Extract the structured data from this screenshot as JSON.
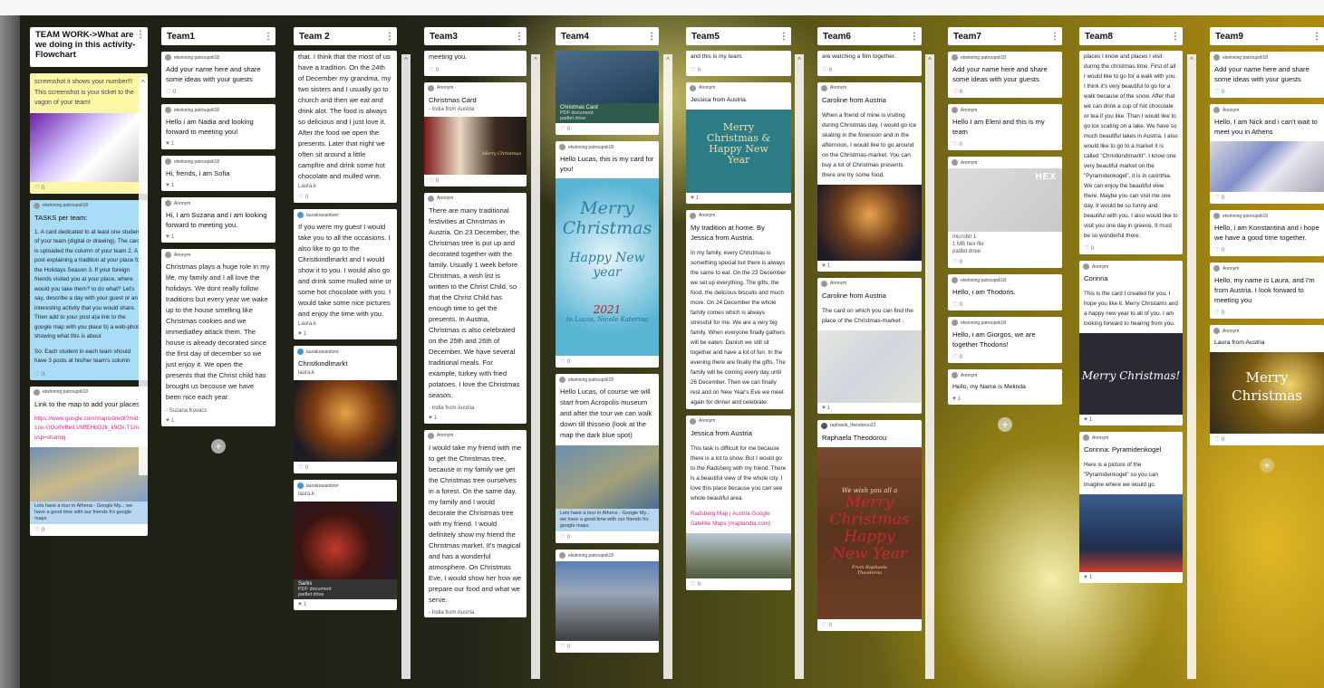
{
  "col0": {
    "header": "TEAM WORK->What are we doing in this activity- Flowchart",
    "c1_text": "screenshot it shows your number!!! This screenshot is your ticket to the vagon of your team!",
    "c2_author": "etwinning patroupoli18",
    "c2_title": "TASKS per team:",
    "c2_body": "1. A card dedicated to at least one student of your team (digital or drawing). The card is uploaded the column of your team 2. A post explaining a tradition at your place for the Holidays Season 3. If your foreign friends visited you at your place, where would you take them? to do what? Let's say, describe a day with your guest or an interesting activity that you would share. Then add to your post a)a link to the google map with you place b) a web-photo showing what this is about",
    "c2_body2": "So: Each student in each team should have 3 posts at his/her team's column",
    "c3_author": "etwinning patroupoli18",
    "c3_title": "Link to the map to add your places",
    "c3_link": "https://www.google.com/maps/d/edit?mid=1nu-GOo0VBeILVMfEHbO2k_k9Ox-T1zI&usp=sharing",
    "c3_cap": "Lets have a tour in Athena - Google My... we have a good time with our friends fro google maps",
    "likes": "0"
  },
  "col1": {
    "header": "Team1",
    "c1_author": "etwinning patroupoli18",
    "c1": "Add your name here and share some ideas with your guests",
    "c2_author": "etwinning patroupoli18",
    "c2": "Hello i am Nadia and looking forward to meeting you!",
    "c3_author": "etwinning patroupoli18",
    "c3": "Hi, frends, i am Sofia",
    "c4_author": "Anonym",
    "c4": "Hi, I am Suzana and i am looking forward to meeting you.",
    "c5_author": "Anonym",
    "c5": "Christmas plays a huge role in my life, my family and I all love the holidays. We dont really follow traditions but every year we wake up to the house smelling like Christmas cookies and we immediatley attack them. The house is already decorated since the first day of december so we just enjoy it. We open the presents that the Christ child has brought us becouse we have been nice each year.",
    "c5_sign": "- Suzana Kovacs",
    "likes1": "0",
    "likes2": "1",
    "likes3": "1",
    "likes4": "1",
    "likes5": "1"
  },
  "col2": {
    "header": "Team 2",
    "c1": "that. I think that the most of us have a tradition. On the 24th of December my grandma, my two sisters and I usually go to church and then we eat and drink alot. The food is always so delicious and I just love it. After the food we open the presents. Later that night we often sit around a little campfire and drink some hot chocolate and mulled wine.",
    "c1_sign": "Laura.k",
    "c2_author": "laurakrasanitzer",
    "c2": "If you were my guest I would take you to all the occasions. I also like to go to the Christkindlmarkt and I would show it to you. I would also go and drink some mulled wine or some hot chocolate with you. I would take some nice pictures and enjoy the time with you.",
    "c2_sign": "Laura.k",
    "c3_author": "laurakrasanitzer",
    "c3": "Christkindlmarkt",
    "c3_sign": "laura.k",
    "c4_author": "laurakrasanitzer",
    "c4_sign": "laura.k",
    "c4_file": "Sarks",
    "c4_filetype": "PDF document",
    "c4_src": "padlet drive",
    "likes1": "0",
    "likes2": "1",
    "likes3": "0",
    "likes4": "1"
  },
  "col3": {
    "header": "Team3",
    "c1": "meeting you.",
    "c2_author": "Anonym",
    "c2": "Christmas Card",
    "c2_sign": "- India from Austria",
    "c2_img": "Merry Christmas",
    "c3_author": "Anonym",
    "c3": "There are many traditional festivities at Christmas in Austria. On 23 December, the Christmas tree is put up and decorated together with the family. Usually 1 week before Christmas, a wish list is written to the Christ Child, so that the Christ Child has enough time to get the presents. In Austria, Christmas is also celebrated on the 25th and 26th of December. We have several traditional meals. For example, turkey with fried potatoes. I love the Christmas season.",
    "c3_sign": "- India from Austria",
    "c4_author": "Anonym",
    "c4": "I would take my friend with me to get the Christmas tree, because in my family we get the Christmas tree ourselves in a forest. On the same day, my family and I would decorate the Christmas tree with my friend. I would definitely show my friend the Christmas market. It's magical and has a wonderful atmosphere. On Christmas Eve, I would show her how we prepare our food and what we serve.",
    "c4_sign": "- India from Austria",
    "likes1": "0",
    "likes2": "0",
    "likes3": "1"
  },
  "col4": {
    "header": "Team4",
    "c1_file": "Christmas Card",
    "c1_filetype": "PDF document",
    "c1_src": "padlet drive",
    "c2_author": "etwinning patroupoli18",
    "c2": "Hello Lucas, this is my card for you!",
    "c2_img1": "Merry Christmas",
    "c2_img2": "Happy New year",
    "c2_img3": "2021",
    "c2_img4": "to Lucas, Nicole Katerina",
    "c3_author": "etwinning patroupoli18",
    "c3": "Hello Lucas, of course we will start from Acropolis museum and after the tour we can walk down till thisseio (look at the map the dark blue spot)",
    "c3_cap": "Lets have a tour in Athens - Google My... we have a good time with our friends fro google maps",
    "c4_author": "etwinning patroupoli18",
    "likes1": "0",
    "likes2": "0",
    "likes3": "0",
    "likes4": "0"
  },
  "col5": {
    "header": "Team5",
    "c1": "and this is my team.",
    "c2_author": "Anonym",
    "c2": "Jessica from Austria.",
    "c2_img": "Merry Christmas & Happy New Year",
    "c3_author": "Anonym",
    "c3": "My tradition at home. By Jessica from Austria.",
    "c3_body": "In my family, every Christmas is something special but there is always the same to eat. On the 23 December we set up everything. The gifts, the food, the delicious biscuits and much more. On 24 December the whole family comes which is always stressful for me. We are a very big family. When everyone finally gathers will be eaten. Danish we still sit together and have a lot of fun. In the evening there are finally the gifts. The family will be coming every day until 26 December. Then we can finally rest and on New Year's Eve we meet again for dinner and celebrate.",
    "c4_author": "Anonym",
    "c4": "Jessica from Austria",
    "c4_body": "This task is difficult for me because there is a lot to show. But I would go to the Radsberg with my friend. There is a beautiful view of the whole city. I love this place because you can see whole beautiful area.",
    "c4_link": "Radsberg Map | Austria Google Satellite Maps (maplandia.com)",
    "likes1": "0",
    "likes2": "1",
    "likes3": "0"
  },
  "col6": {
    "header": "Team6",
    "c1": "are watching a film together.",
    "c2_author": "Anonym",
    "c2": "Caroline from Austria",
    "c2_body": "When a friend of mine is visiting during Christmas day, I would go ice skating in the forenoon and in the afternoon, I would like to go around on the Christmas-market. You can buy a lot of Christmas presents there ore try some food.",
    "c3_author": "Anonym",
    "c3": "Caroline from Austria",
    "c3_body": "The card on which you can find the place of the Christmas-market .",
    "c4_author": "raphaela_theodorou22",
    "c4": "Raphaela Theodorou",
    "c4_img1": "We wish you all a",
    "c4_img2": "Merry Christmas",
    "c4_img3": "Happy New Year",
    "c4_img4": "From Raphaela Theodorou",
    "likes1": "0",
    "likes2": "1",
    "likes3": "1",
    "likes4": "0"
  },
  "col7": {
    "header": "Team7",
    "c1_author": "etwinning patroupoli18",
    "c1": "Add your name here and share some ideas with your guests",
    "c2_author": "Anonym",
    "c2": "Hello I am Eleni and this is my team",
    "c3_author": "Anonym",
    "c3_img": "HEX",
    "c3_file": "microbit 1",
    "c3_filetype": "1 MB hex file",
    "c3_src": "padlet drive",
    "c4_author": "etwinning patroupoli18",
    "c4": "Hello, i am Thodoris.",
    "c5_author": "etwinning patroupoli18",
    "c5": "Hello, i am Giorgos, we are together Thodoris!",
    "c6_author": "Anonym",
    "c6": "Hello, my Name is Melinda",
    "likes1": "0",
    "likes2": "0",
    "likes3": "0",
    "likes4": "0",
    "likes5": "0",
    "likes6": "1"
  },
  "col8": {
    "header": "Team8",
    "c1": "places I know and places I visit during the christmas time. First of all I would like to go for a walk with you. I think it's very beautiful to go for a walk because of the snow. After that we can drink a cup of hot chocolate or tea if you like. Than I would like to go ice scating on a lake. We have so much beautiful lakes in Austria. I also would like to go to a market it is called \"Christkindlmarkt\". I know one very beautiful market on the \"Pyramidenkogel\", it is in carinthia. We can enjoy the beautiful view there. Maybe you can visit me one day. It would be so funny and beautiful with you. I also would like to visit you one day in greece. It must be so wonderful there.",
    "c2_author": "Anonym",
    "c2": "Corinna",
    "c2_body": "This is the card I created for you. I hope you like it. Merry Christams and a happy new year to all of you. I am looking forward to hearing from you.",
    "c2_img": "Merry Christmas!",
    "c3_author": "Anonym",
    "c3": "Corinna: Pyramidenkogel",
    "c3_body": "Here is a picture of the \"Pyramidenkogel\" so you can imagine where we would go.",
    "likes1": "0",
    "likes2": "1",
    "likes3": "1"
  },
  "col9": {
    "header": "Team9",
    "c1_author": "etwinning patroupoli18",
    "c1": "Add your name here and share some ideas with your guests",
    "c2_author": "Anonym",
    "c2": "Hello, I am Nick and i can't wait to meet you in Athens",
    "c3_author": "etwinning patroupoli18",
    "c3": "Hello, i am Konstantina and i hope we have a good time together.",
    "c4_author": "Anonym",
    "c4": "Hello, my name is Laura, and I'm from Austria. I look forward to meeting you",
    "c5_author": "Anonym",
    "c5": "Laura from Austria",
    "c5_img": "Merry Christmas",
    "likes1": "0",
    "likes2": "0",
    "likes3": "0",
    "likes4": "0",
    "likes5": "0"
  },
  "icons": {
    "like": "heart-icon",
    "menu": "more-vertical-icon",
    "add": "plus-icon",
    "scroll_up": "chevron-up-icon",
    "scroll_down": "chevron-down-icon"
  }
}
